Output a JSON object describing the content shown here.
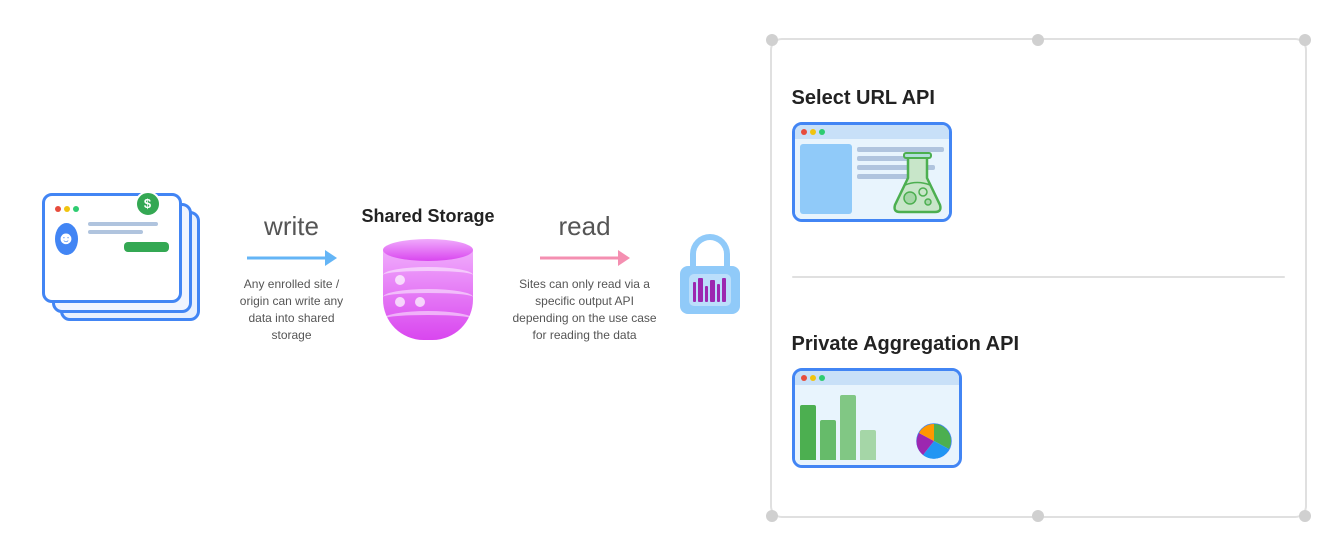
{
  "left": {
    "write_label": "write",
    "write_description": "Any enrolled site / origin can write any data into shared storage"
  },
  "shared_storage": {
    "title": "Shared Storage"
  },
  "read": {
    "label": "read",
    "description": "Sites can only read via a specific output API depending on the use case for reading the data"
  },
  "right_panel": {
    "select_url": {
      "title": "Select URL API"
    },
    "private_aggregation": {
      "title": "Private Aggregation API"
    }
  },
  "colors": {
    "blue": "#4285f4",
    "pink": "#e879f9",
    "light_blue_arrow": "#64b5f6",
    "pink_arrow": "#f48fb1",
    "green": "#34a853",
    "lock_blue": "#90caf9"
  }
}
